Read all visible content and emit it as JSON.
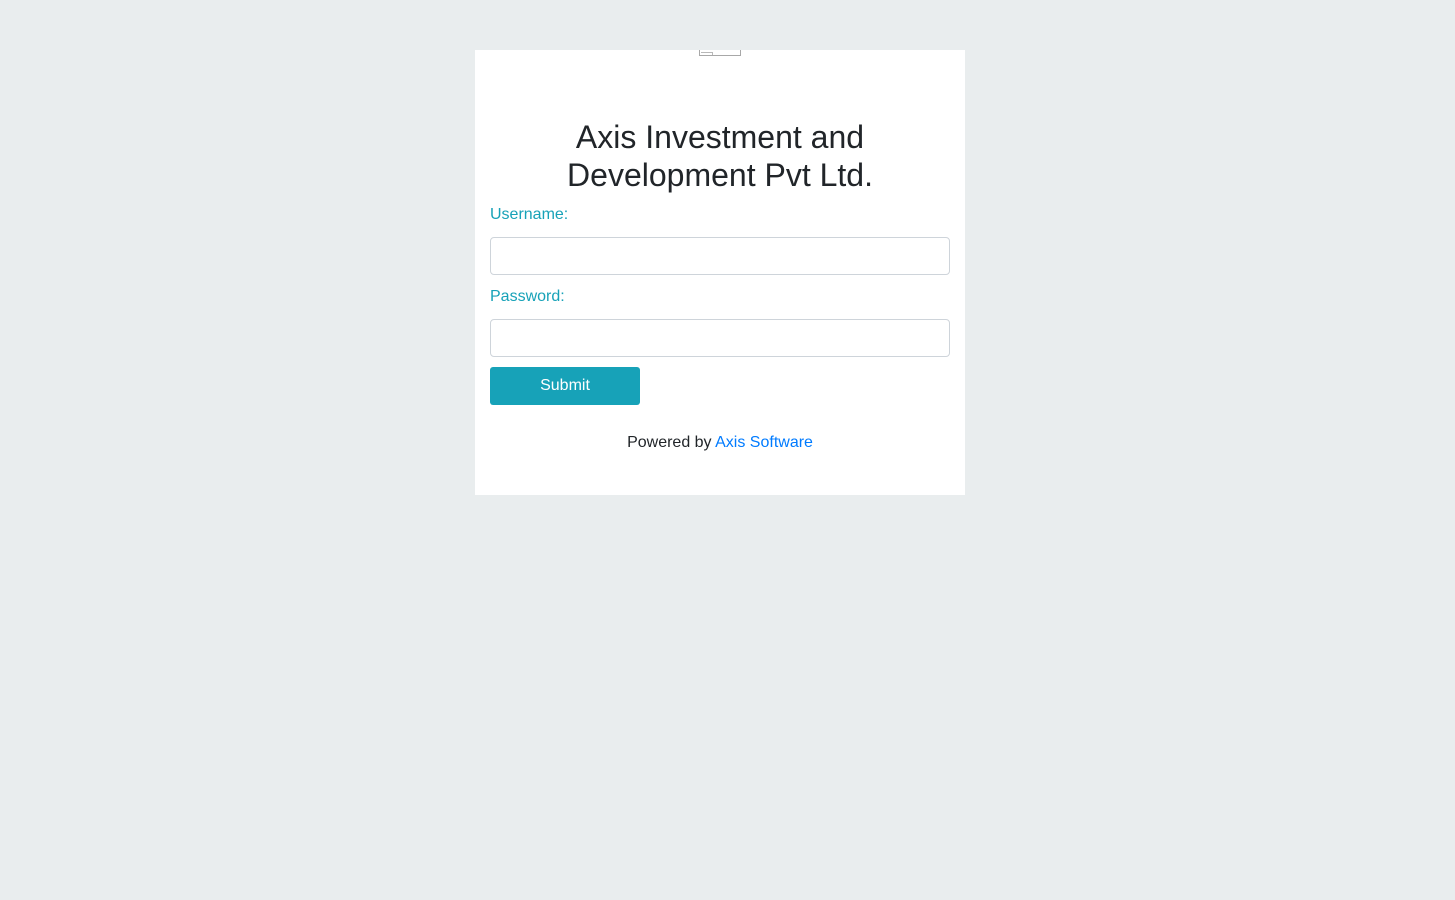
{
  "company": {
    "title_line1": "Axis Investment and",
    "title_line2": "Development Pvt Ltd.",
    "logo_icon": "broken-image-icon"
  },
  "form": {
    "username_label": "Username:",
    "username_value": "",
    "password_label": "Password:",
    "password_value": "",
    "submit_label": "Submit"
  },
  "footer": {
    "powered_by": "Powered by",
    "link_text": "Axis Software"
  },
  "colors": {
    "background": "#e9edee",
    "accent": "#17a2b8",
    "link": "#007bff",
    "text": "#212529"
  }
}
